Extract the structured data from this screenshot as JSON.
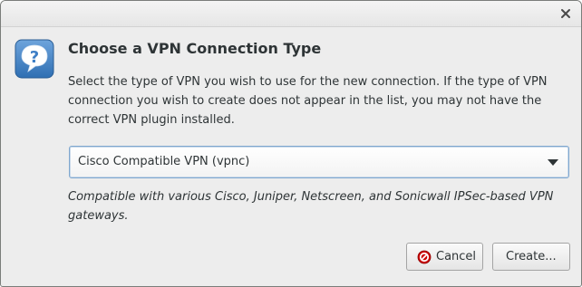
{
  "window": {
    "close_icon": "close-icon"
  },
  "dialog": {
    "icon": "question-icon",
    "icon_color": "#3d7ec6",
    "heading": "Choose a VPN Connection Type",
    "description": "Select the type of VPN you wish to use for the new connection.  If the type of VPN connection you wish to create does not appear in the list, you may not have the correct VPN plugin installed.",
    "vpn_type_select": {
      "selected": "Cisco Compatible VPN (vpnc)",
      "focus_color": "#7fa7cf"
    },
    "vpn_type_note": "Compatible with various Cisco, Juniper, Netscreen, and Sonicwall IPSec-based VPN gateways."
  },
  "buttons": {
    "cancel_label": "Cancel",
    "cancel_icon": "cancel-icon",
    "cancel_icon_color": "#cc0000",
    "create_label": "Create..."
  }
}
